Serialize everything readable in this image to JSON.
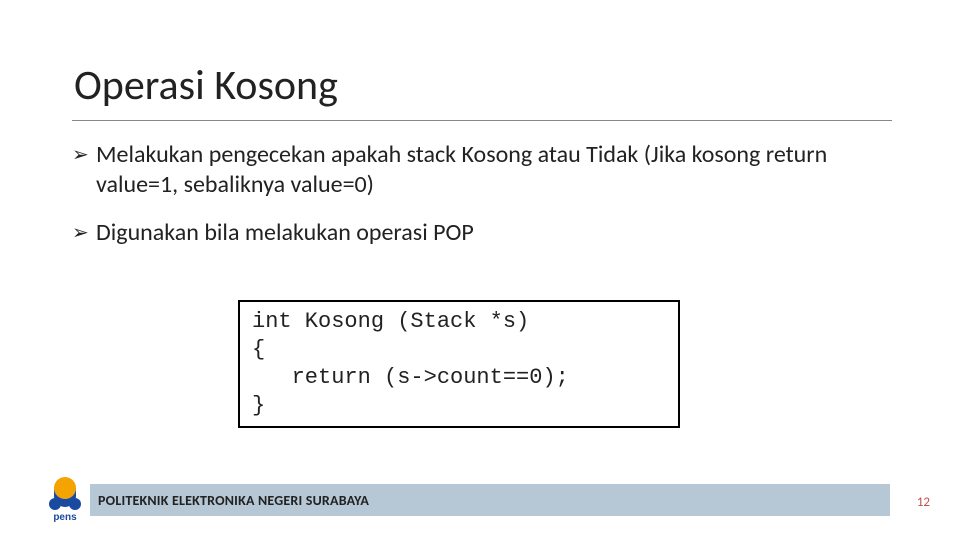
{
  "title": "Operasi Kosong",
  "bullets": [
    "Melakukan pengecekan apakah stack Kosong atau Tidak (Jika kosong return value=1, sebaliknya value=0)",
    "Digunakan bila melakukan operasi POP"
  ],
  "code": "int Kosong (Stack *s)\n{\n   return (s->count==0);\n}",
  "footer": "POLITEKNIK ELEKTRONIKA NEGERI SURABAYA",
  "page_number": "12",
  "logo_label": "pens"
}
